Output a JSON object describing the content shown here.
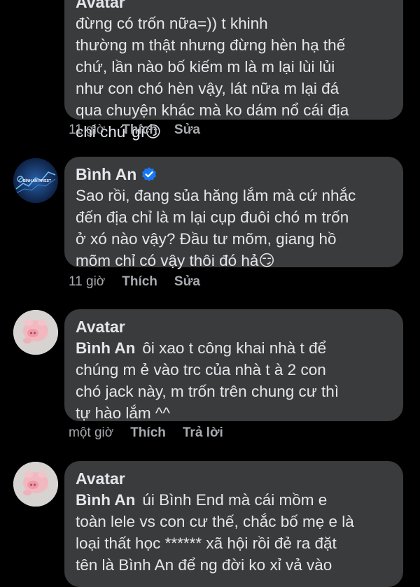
{
  "comments": [
    {
      "author": "Avatar",
      "lines": [
        "đừng có trốn nữa=)) t khinh",
        "thường m thật nhưng đừng hèn hạ thế",
        "chứ, lần nào bố kiếm m là m lại lùi lủi",
        "như con chó hèn vậy, lát nữa m lại đá",
        "qua chuyện khác mà ko dám nổ cái địa",
        "chỉ chứ gì😏"
      ],
      "time": "11 giờ",
      "like": "Thích",
      "second_action": "Sửa"
    },
    {
      "author": "Bình An",
      "verified": true,
      "avatar_logo_text": "BÌNH AN INVEST",
      "lines": [
        "Sao rồi, đang sủa hăng lắm mà cứ nhắc",
        "đến địa chỉ là m lại cụp đuôi chó m trốn",
        "ở xó nào vậy? Đầu tư mõm, giang hồ",
        "mõm chỉ có vậy thôi đó hả😏"
      ],
      "time": "11 giờ",
      "like": "Thích",
      "second_action": "Sửa"
    },
    {
      "author": "Avatar",
      "mention": "Bình An",
      "lines": [
        "ôi xao t công khai nhà t để",
        "chúng m ẻ vào trc của nhà t à 2 con",
        "chó jack này, m trốn trên chung cư thì",
        "tự hào lắm ^^"
      ],
      "time": "một giờ",
      "like": "Thích",
      "second_action": "Trả lời"
    },
    {
      "author": "Avatar",
      "mention": "Bình An",
      "lines": [
        "úi Bình End mà cái mồm e",
        "toàn lele vs con cư thế, chắc bố mẹ e là",
        "loại thất học ****** xã hội rồi đẻ ra đặt",
        "tên là Bình An để ng đời ko xỉ vả vào"
      ]
    }
  ],
  "colors": {
    "background": "#000000",
    "bubble": "#3a3b3c",
    "text": "#e4e6eb",
    "muted": "#a8abaf",
    "verified": "#1877f2"
  }
}
